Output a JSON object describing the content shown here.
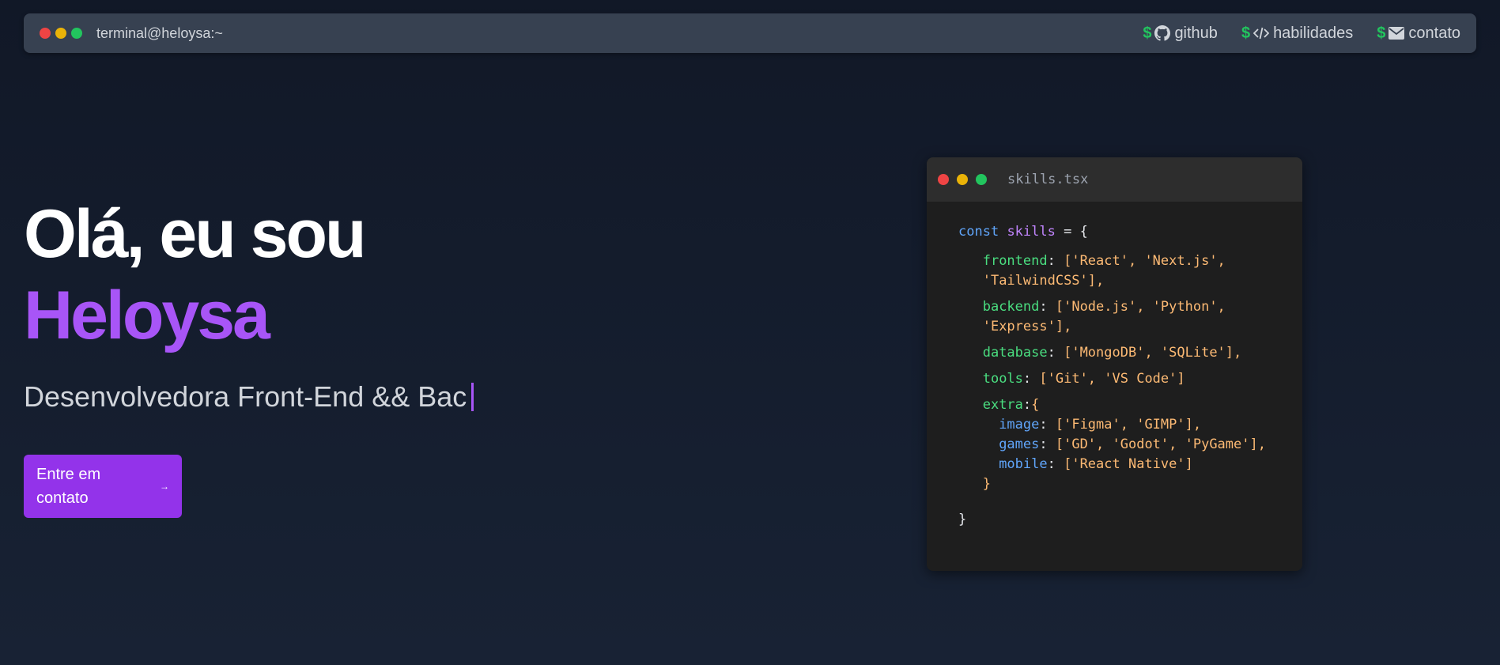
{
  "navbar": {
    "title": "terminal@heloysa:~",
    "prompt_symbol": "$",
    "links": [
      {
        "label": "github",
        "icon": "github-icon"
      },
      {
        "label": "habilidades",
        "icon": "code-icon"
      },
      {
        "label": "contato",
        "icon": "envelope-icon"
      }
    ]
  },
  "hero": {
    "greeting": "Olá, eu sou",
    "name": "Heloysa",
    "subtitle": "Desenvolvedora Front-End && Bac",
    "cta_label": "Entre em contato",
    "cta_arrow": "→"
  },
  "code_window": {
    "filename": "skills.tsx",
    "const_kw": "const",
    "var_name": "skills",
    "assign": " = {",
    "frontend_key": "frontend",
    "frontend_values_1": "['React', 'Next.js',",
    "frontend_values_2": "'TailwindCSS'],",
    "backend_key": "backend",
    "backend_values_1": "['Node.js', 'Python',",
    "backend_values_2": "'Express'],",
    "database_key": "database",
    "database_values": "['MongoDB', 'SQLite'],",
    "tools_key": "tools",
    "tools_values": "['Git', 'VS Code']",
    "extra_key": "extra",
    "extra_open": "{",
    "image_key": "image",
    "image_values": "['Figma', 'GIMP'],",
    "games_key": "games",
    "games_values": "['GD', 'Godot', 'PyGame'],",
    "mobile_key": "mobile",
    "mobile_values": "['React Native']",
    "extra_close": "}",
    "close_brace": "}"
  },
  "colors": {
    "accent": "#a855f7",
    "button": "#9333ea",
    "prompt": "#22c55e",
    "navbar_bg": "#374151",
    "code_bg": "#1e1e1e"
  }
}
